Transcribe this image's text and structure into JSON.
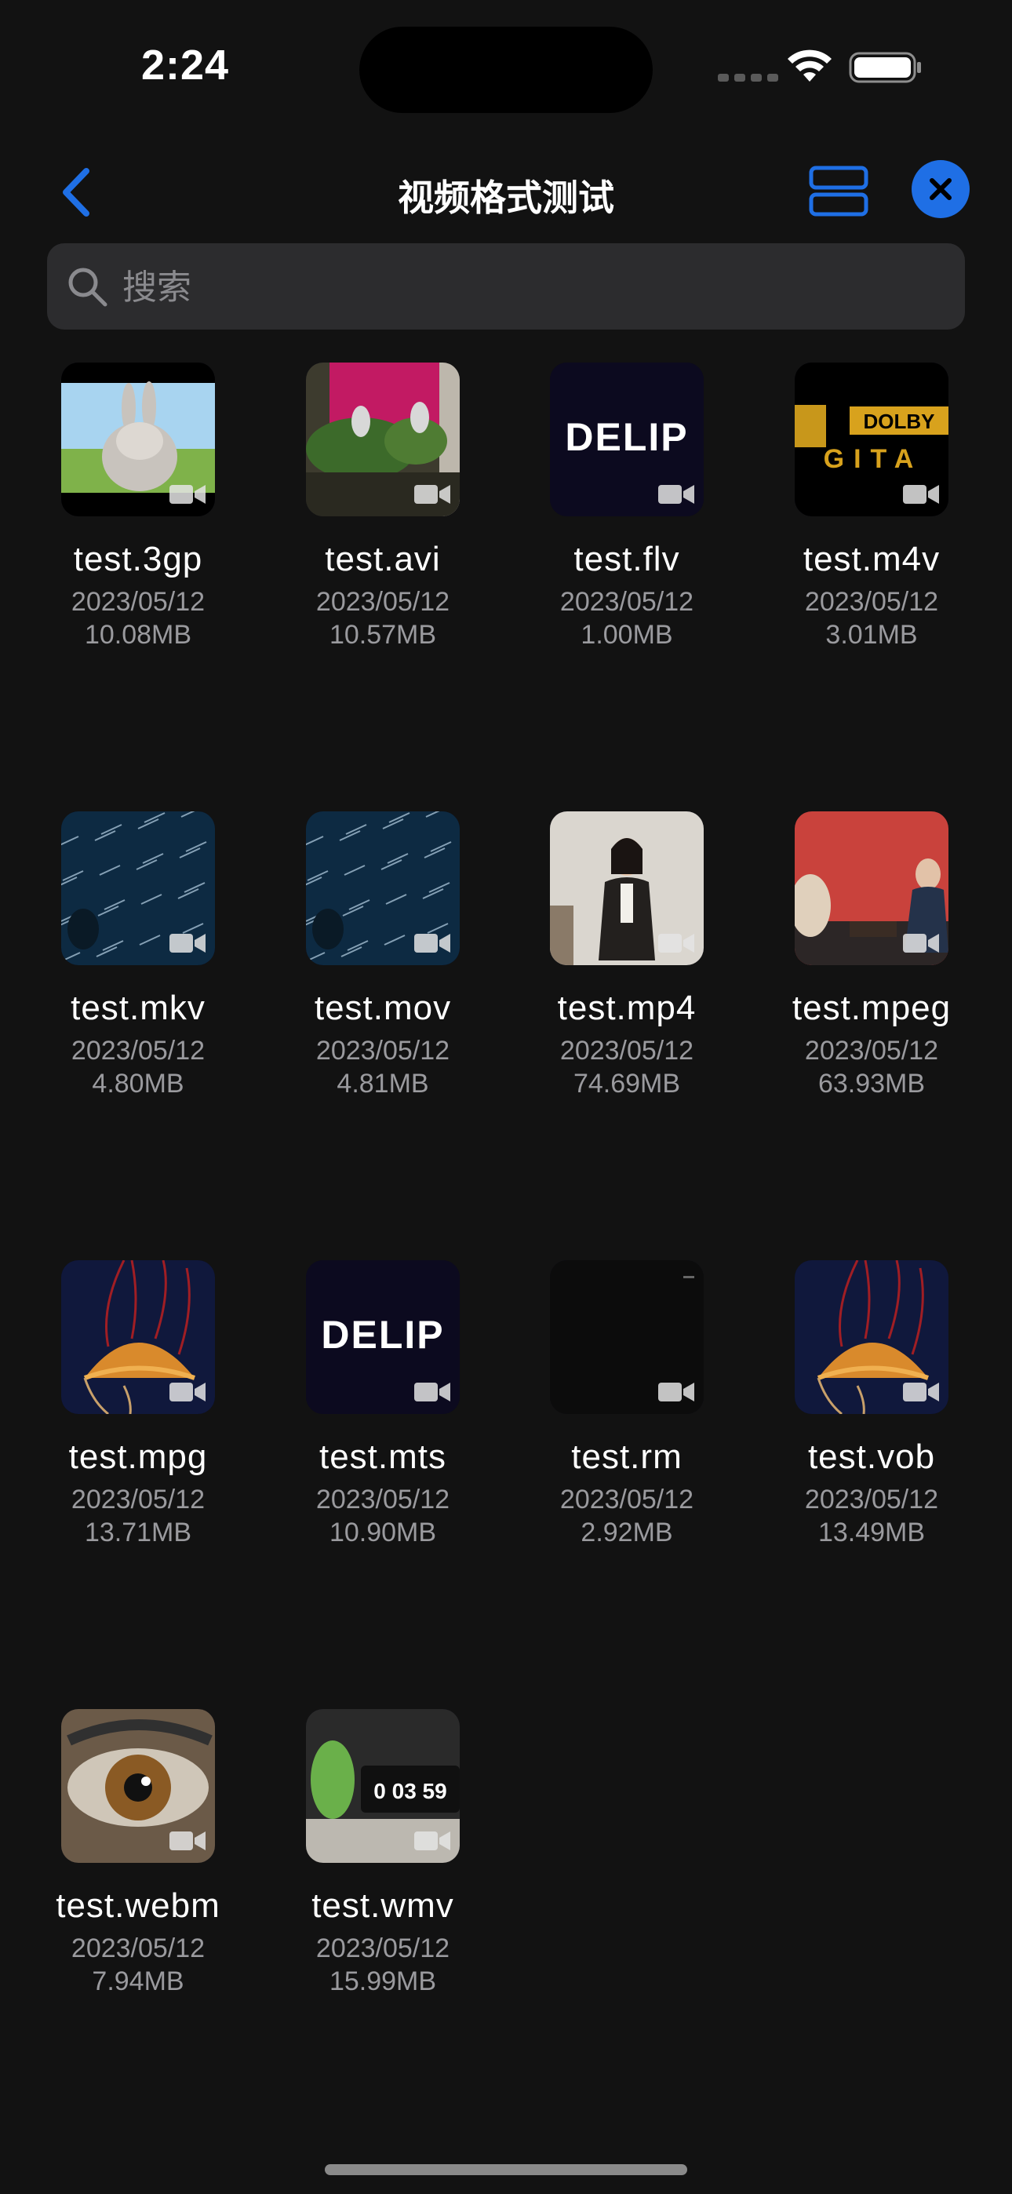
{
  "status_bar": {
    "time": "2:24"
  },
  "nav": {
    "title": "视频格式测试",
    "back_icon": "chevron-left-icon",
    "layout_icon": "list-layout-icon",
    "close_icon": "close-icon"
  },
  "search": {
    "placeholder": "搜索",
    "value": ""
  },
  "colors": {
    "accent": "#1f6fe5",
    "background": "#121212",
    "secondary_text": "#9a9a9e"
  },
  "files": [
    {
      "name": "test.3gp",
      "date": "2023/05/12",
      "size": "10.08MB",
      "thumb": "bunny"
    },
    {
      "name": "test.avi",
      "date": "2023/05/12",
      "size": "10.57MB",
      "thumb": "garden"
    },
    {
      "name": "test.flv",
      "date": "2023/05/12",
      "size": "1.00MB",
      "thumb": "logo"
    },
    {
      "name": "test.m4v",
      "date": "2023/05/12",
      "size": "3.01MB",
      "thumb": "dolby"
    },
    {
      "name": "test.mkv",
      "date": "2023/05/12",
      "size": "4.80MB",
      "thumb": "stars"
    },
    {
      "name": "test.mov",
      "date": "2023/05/12",
      "size": "4.81MB",
      "thumb": "stars"
    },
    {
      "name": "test.mp4",
      "date": "2023/05/12",
      "size": "74.69MB",
      "thumb": "person"
    },
    {
      "name": "test.mpeg",
      "date": "2023/05/12",
      "size": "63.93MB",
      "thumb": "stage"
    },
    {
      "name": "test.mpg",
      "date": "2023/05/12",
      "size": "13.71MB",
      "thumb": "jelly"
    },
    {
      "name": "test.mts",
      "date": "2023/05/12",
      "size": "10.90MB",
      "thumb": "logo"
    },
    {
      "name": "test.rm",
      "date": "2023/05/12",
      "size": "2.92MB",
      "thumb": "black"
    },
    {
      "name": "test.vob",
      "date": "2023/05/12",
      "size": "13.49MB",
      "thumb": "jelly"
    },
    {
      "name": "test.webm",
      "date": "2023/05/12",
      "size": "7.94MB",
      "thumb": "eye"
    },
    {
      "name": "test.wmv",
      "date": "2023/05/12",
      "size": "15.99MB",
      "thumb": "clock"
    }
  ],
  "thumb_texts": {
    "logo": "DELIP",
    "dolby_top": "DOLBY",
    "dolby_bottom": "GITA",
    "clock": "0 03 59"
  }
}
